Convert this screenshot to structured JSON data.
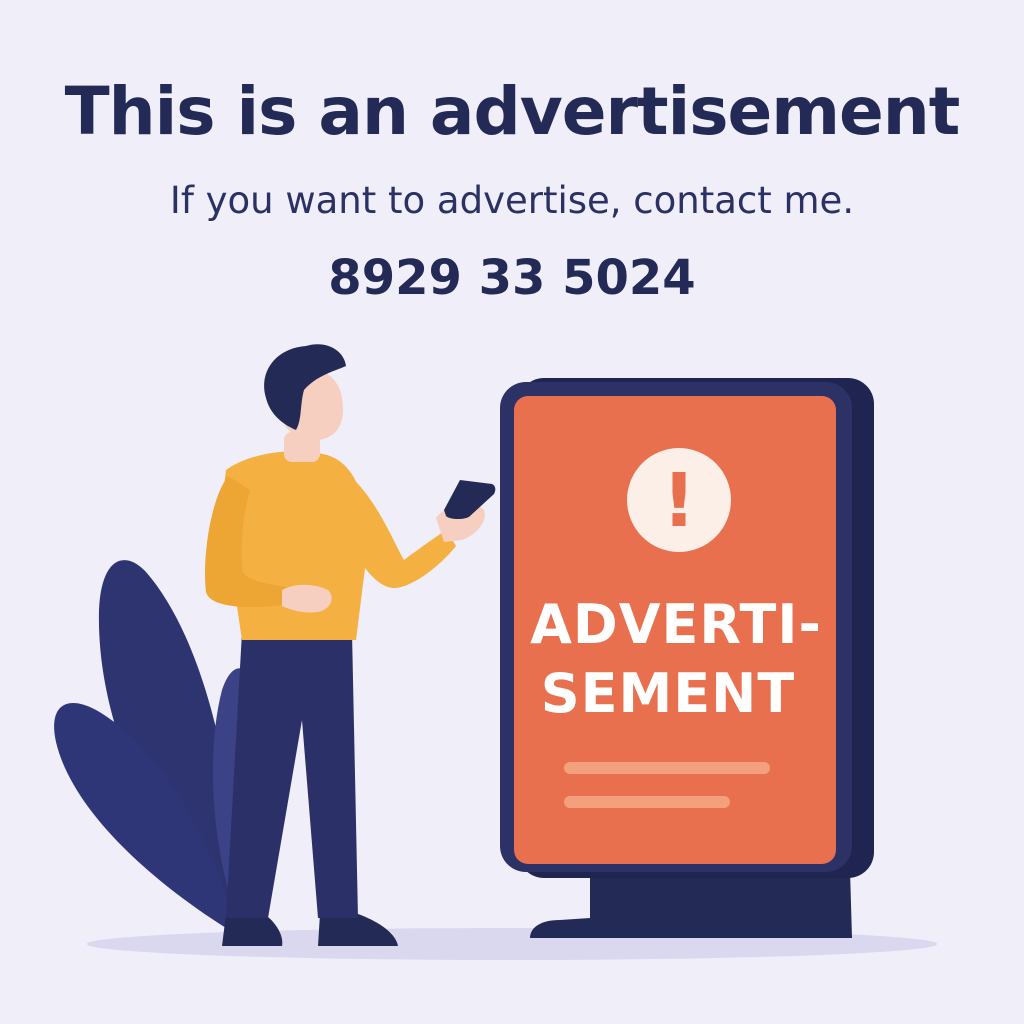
{
  "headline": "This is an advertisement",
  "subline": "If you want to advertise, contact me.",
  "phone": "8929 33 5024",
  "sign": {
    "line1": "ADVERTI-",
    "line2": "SEMENT",
    "alert_glyph": "!"
  },
  "colors": {
    "background": "#efeef9",
    "navy": "#232a55",
    "sign_orange": "#e8704e",
    "shirt_yellow": "#f4b041",
    "skin": "#f6cfc0",
    "leaf": "#2d3470"
  },
  "icons": [
    "alert-icon"
  ]
}
